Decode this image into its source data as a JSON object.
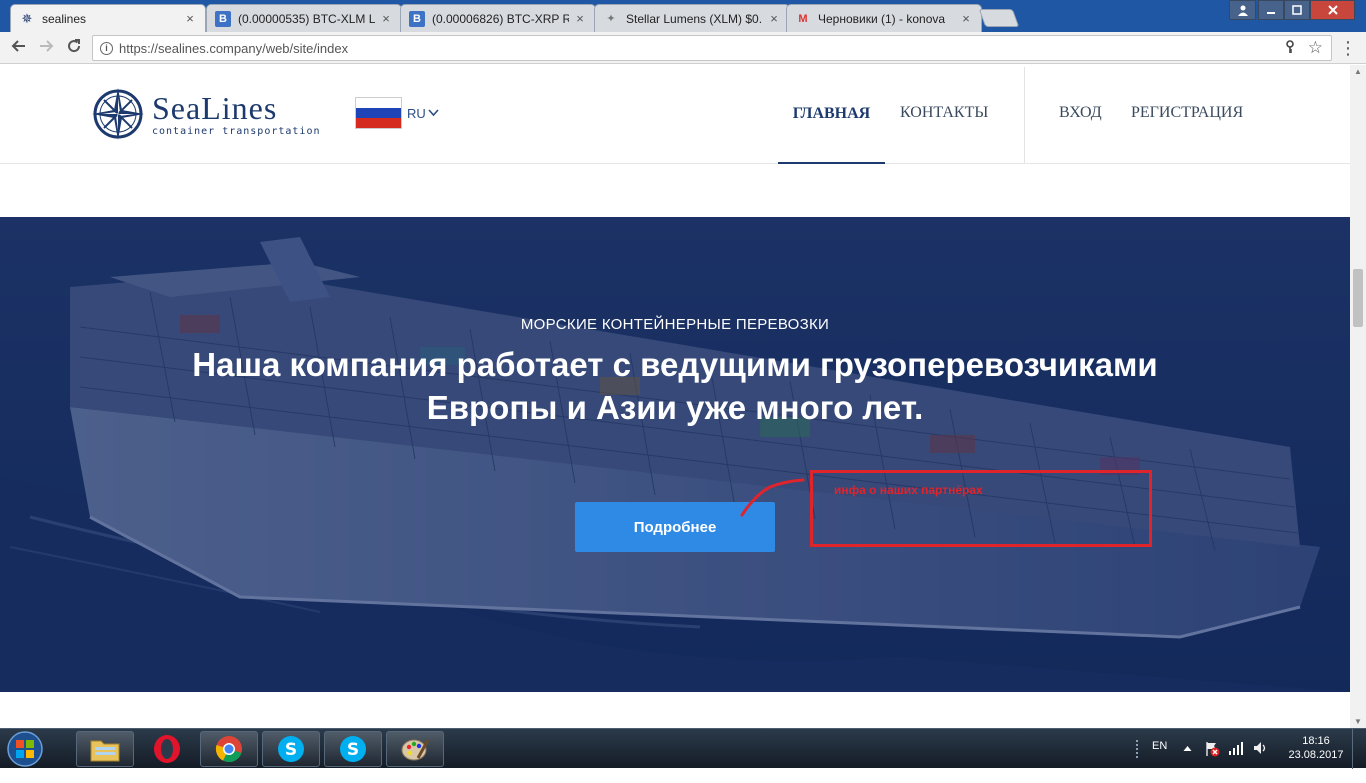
{
  "browser": {
    "tabs": [
      {
        "title": "sealines",
        "favicon": "sealines-compass-icon",
        "active": true
      },
      {
        "title": "(0.00000535) BTC-XLM L",
        "favicon": "bittrex-b-icon",
        "active": false
      },
      {
        "title": "(0.00006826) BTC-XRP R",
        "favicon": "bittrex-b-icon",
        "active": false
      },
      {
        "title": "Stellar Lumens (XLM) $0.",
        "favicon": "stellar-icon",
        "active": false
      },
      {
        "title": "Черновики (1) - konova",
        "favicon": "gmail-icon",
        "active": false
      }
    ],
    "tab_close_glyph": "×",
    "address": {
      "url": "https://sealines.company/web/site/index"
    }
  },
  "site": {
    "logo": {
      "name": "SeaLines",
      "tagline": "container transportation"
    },
    "language": {
      "code": "RU",
      "flag_colors": [
        "#ffffff",
        "#1f44b8",
        "#d52b1e"
      ]
    },
    "nav": {
      "home": "ГЛАВНАЯ",
      "contacts": "КОНТАКТЫ",
      "login": "ВХОД",
      "register": "РЕГИСТРАЦИЯ"
    },
    "hero": {
      "kicker": "МОРСКИЕ КОНТЕЙНЕРНЫЕ ПЕРЕВОЗКИ",
      "title_line1": "Наша компания работает с ведущими грузоперевозчиками",
      "title_line2": "Европы и Азии уже много лет.",
      "button": "Подробнее",
      "annotation": "инфа о наших партнёрах"
    },
    "colors": {
      "brand_navy": "#1d3a6e",
      "button_blue": "#2f8ae5",
      "annotation_red": "#e0242c",
      "hero_overlay": "#1b3266"
    }
  },
  "taskbar": {
    "apps": [
      "file-explorer-icon",
      "opera-icon",
      "chrome-icon",
      "skype-icon",
      "skype-icon",
      "paint-icon"
    ],
    "language": "EN",
    "time": "18:16",
    "date": "23.08.2017"
  }
}
